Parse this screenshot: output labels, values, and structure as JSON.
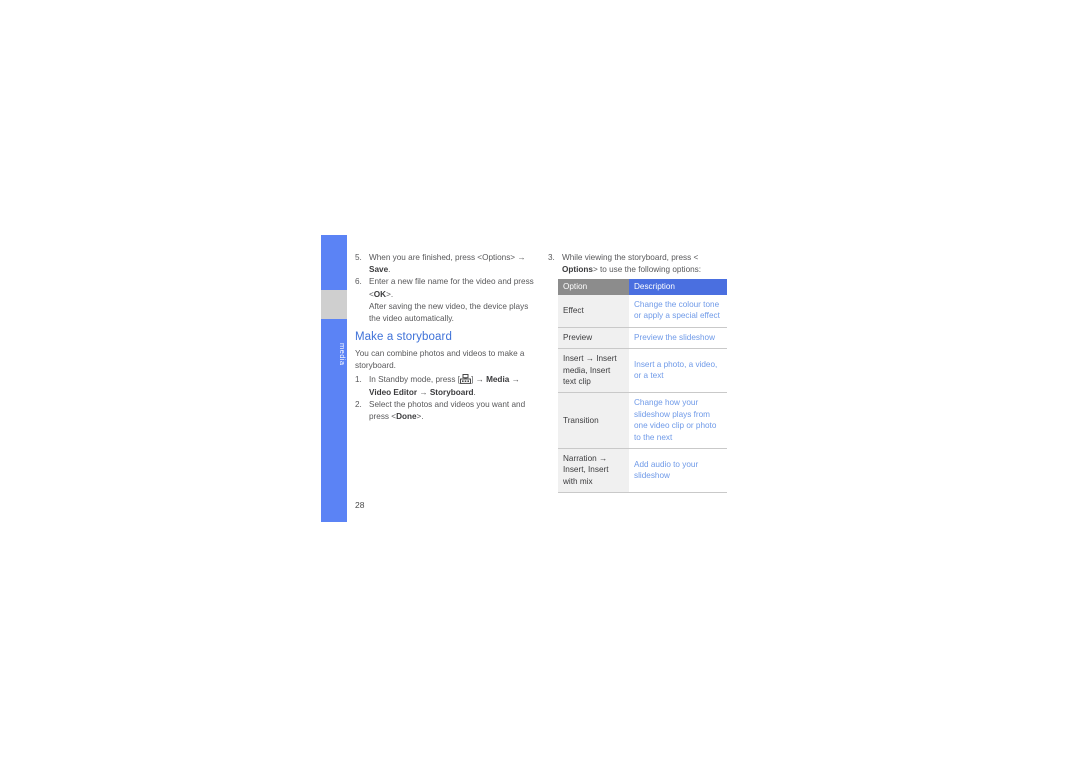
{
  "sidebar": {
    "label": "media"
  },
  "page_number": "28",
  "left_column": {
    "step5": {
      "num": "5.",
      "text_before": "When you are finished, press <Options> ",
      "arrow": "→",
      "bold": "Save",
      "tail": "."
    },
    "step6": {
      "num": "6.",
      "line1": "Enter a new file name for the video and press <",
      "bold": "OK",
      "line1_tail": ">.",
      "note": "After saving the new video, the device plays the video automatically."
    }
  },
  "section": {
    "heading": "Make a storyboard",
    "intro": "You can combine photos and videos to make a storyboard.",
    "step1": {
      "num": "1.",
      "pre": "In Standby mode, press [",
      "icon": "menu-key-icon",
      "post": "] ",
      "arrow1": "→",
      "bold1": "Media",
      "arrow2": "→",
      "bold2": "Video Editor",
      "arrow3": "→",
      "bold3": "Storyboard",
      "tail": "."
    },
    "step2": {
      "num": "2.",
      "pre": "Select the photos and videos you want and press <",
      "bold": "Done",
      "tail": ">."
    }
  },
  "right_column": {
    "step3": {
      "num": "3.",
      "line1": "While viewing the storyboard, press <",
      "bold": "Options",
      "line2": "> to use the following options:"
    },
    "table": {
      "headers": [
        "Option",
        "Description"
      ],
      "rows": [
        {
          "option": "Effect",
          "description": "Change the colour tone or apply a special effect"
        },
        {
          "option": "Preview",
          "description": "Preview the slideshow"
        },
        {
          "option": "Insert → Insert media, Insert text clip",
          "description": "Insert a photo, a video, or a text"
        },
        {
          "option": "Transition",
          "description": "Change how your slideshow plays from one video clip or photo to the next"
        },
        {
          "option": "Narration → Insert, Insert with mix",
          "description": "Add audio to your slideshow"
        }
      ]
    }
  },
  "colors": {
    "tab_blue": "#5b83f5",
    "tab_gray": "#cfcfcf",
    "heading_blue": "#3f72d8",
    "table_header_blue": "#4a6fe0",
    "table_header_gray": "#8c8c8c",
    "desc_text_blue": "#6f9ae8",
    "body_text": "#58585a"
  }
}
